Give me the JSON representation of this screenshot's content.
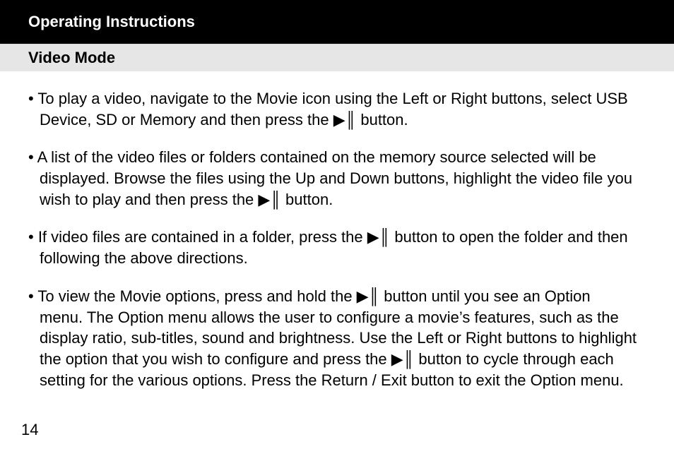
{
  "header": {
    "title": "Operating Instructions"
  },
  "subheader": {
    "title": "Video Mode"
  },
  "symbols": {
    "play_pause": "▶║"
  },
  "bullets": [
    {
      "first": "• To play a video, navigate to the Movie icon using the Left or Right buttons, select USB",
      "cont": [
        "Device, SD or Memory and then press the  ▶║  button."
      ]
    },
    {
      "first": "• A list of the video files or folders contained on the memory source selected will be",
      "cont": [
        "displayed. Browse the files using the Up and Down buttons, highlight the video file you",
        "wish to play and then press the  ▶║  button."
      ]
    },
    {
      "first": "• If video files are contained in a folder, press the  ▶║  button to open the folder and then",
      "cont": [
        "following the above directions."
      ]
    },
    {
      "first": "• To view the Movie options, press and hold the  ▶║  button until you see an Option",
      "cont": [
        "menu. The Option menu allows the user to configure a movie’s features, such as the",
        "display ratio, sub-titles, sound and brightness. Use the Left or Right buttons to highlight",
        "the option that you wish to configure and press the  ▶║  button to cycle through each",
        "setting for the various options. Press the Return / Exit button to exit the Option menu."
      ]
    }
  ],
  "page_number": "14"
}
